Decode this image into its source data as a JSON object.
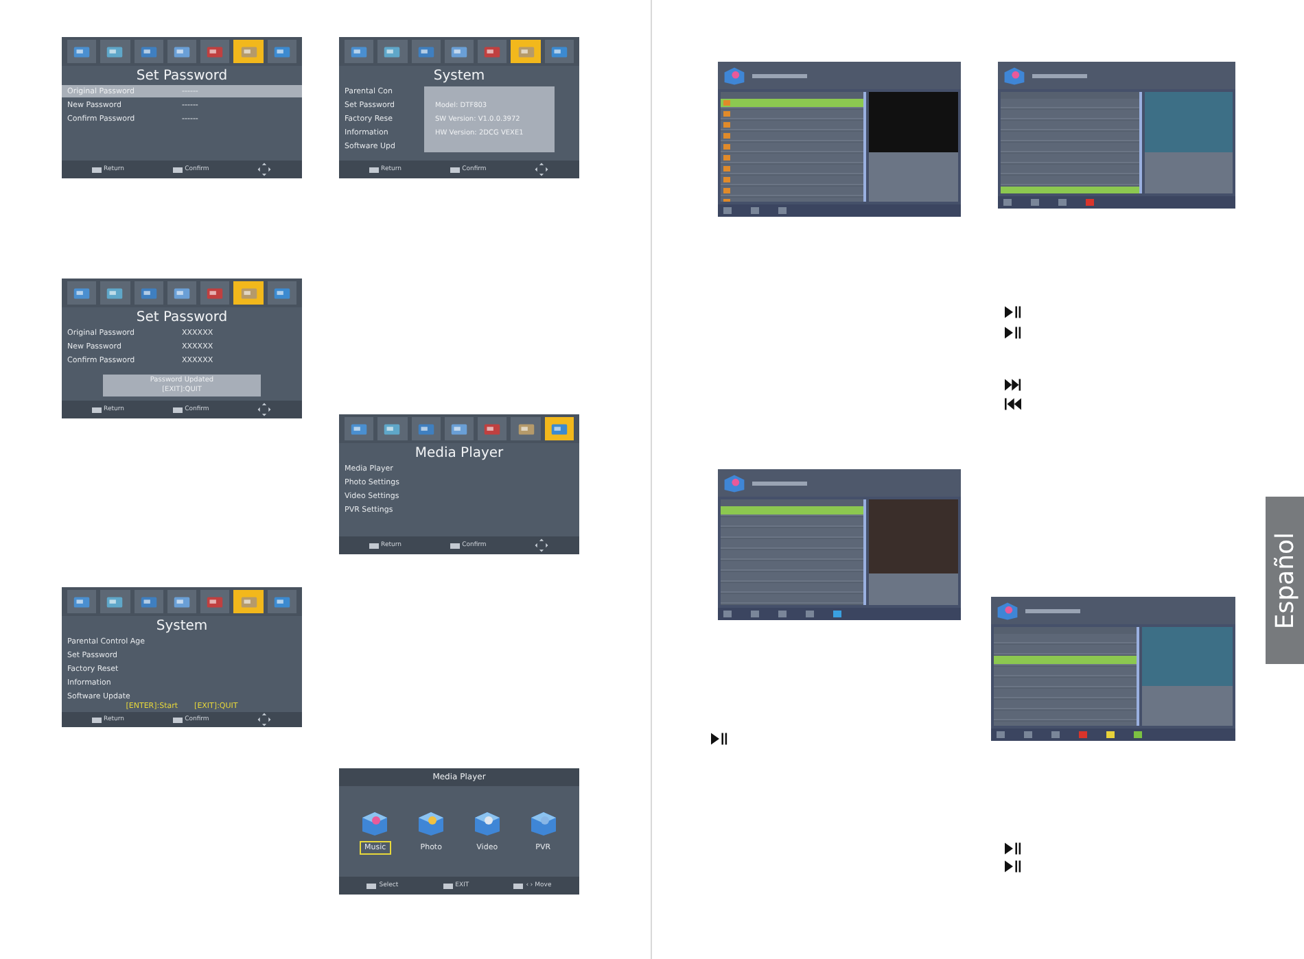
{
  "left_page": {
    "screens": [
      {
        "kind": "menu",
        "tabs": [
          {
            "selected": false
          },
          {
            "selected": false
          },
          {
            "selected": false
          },
          {
            "selected": false
          },
          {
            "selected": false
          },
          {
            "selected": true
          },
          {
            "selected": false
          }
        ],
        "title": "Set Password",
        "rows": [
          {
            "label": "Original Password",
            "value": "------",
            "selected": true
          },
          {
            "label": "New Password",
            "value": "------",
            "selected": false
          },
          {
            "label": "Confirm Password",
            "value": "------",
            "selected": false
          }
        ],
        "footer": [
          "Return",
          "Confirm"
        ]
      },
      {
        "kind": "menu",
        "tabs": [
          {
            "selected": false
          },
          {
            "selected": false
          },
          {
            "selected": false
          },
          {
            "selected": false
          },
          {
            "selected": false
          },
          {
            "selected": true
          },
          {
            "selected": false
          }
        ],
        "title": "System",
        "rows": [
          {
            "label": "Parental Con",
            "selected": false
          },
          {
            "label": "Set Password",
            "selected": false
          },
          {
            "label": "Factory Rese",
            "selected": false
          },
          {
            "label": "Information",
            "selected": false
          },
          {
            "label": "Software Upd",
            "selected": false
          }
        ],
        "popup": [
          "Model: DTF803",
          "SW Version: V1.0.0.3972",
          "HW Version: 2DCG VEXE1"
        ],
        "footer": [
          "Return",
          "Confirm"
        ]
      },
      {
        "kind": "menu",
        "tabs": [
          {
            "selected": false
          },
          {
            "selected": false
          },
          {
            "selected": false
          },
          {
            "selected": false
          },
          {
            "selected": false
          },
          {
            "selected": true
          },
          {
            "selected": false
          }
        ],
        "title": "Set Password",
        "rows": [
          {
            "label": "Original Password",
            "value": "XXXXXX",
            "selected": false
          },
          {
            "label": "New Password",
            "value": "XXXXXX",
            "selected": false
          },
          {
            "label": "Confirm Password",
            "value": "XXXXXX",
            "selected": false
          }
        ],
        "message": [
          "Password Updated",
          "[EXIT]:QUIT"
        ],
        "footer": [
          "Return",
          "Confirm"
        ]
      },
      {
        "kind": "menu",
        "tabs": [
          {
            "selected": false
          },
          {
            "selected": false
          },
          {
            "selected": false
          },
          {
            "selected": false
          },
          {
            "selected": false
          },
          {
            "selected": false
          },
          {
            "selected": true
          }
        ],
        "title": "Media Player",
        "rows": [
          {
            "label": "Media Player",
            "selected": false
          },
          {
            "label": "Photo Settings",
            "selected": false
          },
          {
            "label": "Video Settings",
            "selected": false
          },
          {
            "label": "PVR  Settings",
            "selected": false
          }
        ],
        "footer": [
          "Return",
          "Confirm"
        ]
      },
      {
        "kind": "menu",
        "tabs": [
          {
            "selected": false
          },
          {
            "selected": false
          },
          {
            "selected": false
          },
          {
            "selected": false
          },
          {
            "selected": false
          },
          {
            "selected": true
          },
          {
            "selected": false
          }
        ],
        "title": "System",
        "rows": [
          {
            "label": "Parental Control Age",
            "selected": false
          },
          {
            "label": "Set Password",
            "selected": false
          },
          {
            "label": "Factory Reset",
            "selected": false
          },
          {
            "label": "Information",
            "selected": false
          },
          {
            "label": "Software Update",
            "selected": false
          }
        ],
        "hints": [
          "[ENTER]:Start",
          "[EXIT]:QUIT"
        ],
        "footer": [
          "Return",
          "Confirm"
        ]
      },
      {
        "kind": "media",
        "title": "Media Player",
        "items": [
          {
            "label": "Music",
            "selected": true
          },
          {
            "label": "Photo",
            "selected": false
          },
          {
            "label": "Video",
            "selected": false
          },
          {
            "label": "PVR",
            "selected": false
          }
        ],
        "footer": [
          "Select",
          "EXIT",
          "‹ › Move"
        ]
      }
    ]
  },
  "right_page": {
    "browsers": [
      {
        "preview": {
          "kind": "black"
        },
        "rows": [
          {
            "kind": "folder",
            "selected": true
          },
          {
            "kind": "folder",
            "selected": false
          },
          {
            "kind": "folder",
            "selected": false
          },
          {
            "kind": "folder",
            "selected": false
          },
          {
            "kind": "folder",
            "selected": false
          },
          {
            "kind": "folder",
            "selected": false
          },
          {
            "kind": "folder",
            "selected": false
          },
          {
            "kind": "folder",
            "selected": false
          },
          {
            "kind": "folder",
            "selected": false
          },
          {
            "kind": "folder",
            "selected": false
          }
        ],
        "keys": [
          {
            "color": "#7a8699"
          },
          {
            "color": "#7a8699"
          },
          {
            "color": "#7a8699"
          }
        ]
      },
      {
        "preview": {
          "kind": "video"
        },
        "rows": [
          {
            "kind": "file",
            "selected": false
          },
          {
            "kind": "file",
            "selected": false
          },
          {
            "kind": "file",
            "selected": false
          },
          {
            "kind": "file",
            "selected": false
          },
          {
            "kind": "file",
            "selected": false
          },
          {
            "kind": "file",
            "selected": false
          },
          {
            "kind": "file",
            "selected": false
          },
          {
            "kind": "file",
            "selected": false
          },
          {
            "kind": "file",
            "selected": true
          }
        ],
        "keys": [
          {
            "color": "#7a8699"
          },
          {
            "color": "#7a8699"
          },
          {
            "color": "#7a8699"
          },
          {
            "color": "#d9342b"
          }
        ]
      },
      {
        "preview": {
          "kind": "photo"
        },
        "rows": [
          {
            "kind": "file",
            "selected": true
          },
          {
            "kind": "file",
            "selected": false
          },
          {
            "kind": "file",
            "selected": false
          },
          {
            "kind": "file",
            "selected": false
          },
          {
            "kind": "file",
            "selected": false
          },
          {
            "kind": "file",
            "selected": false
          },
          {
            "kind": "file",
            "selected": false
          },
          {
            "kind": "file",
            "selected": false
          },
          {
            "kind": "file",
            "selected": false
          }
        ],
        "keys": [
          {
            "color": "#7a8699"
          },
          {
            "color": "#7a8699"
          },
          {
            "color": "#7a8699"
          },
          {
            "color": "#7a8699"
          },
          {
            "color": "#3aa0e0"
          }
        ]
      },
      {
        "preview": {
          "kind": "video"
        },
        "rows": [
          {
            "kind": "file",
            "selected": false
          },
          {
            "kind": "file",
            "selected": false
          },
          {
            "kind": "file",
            "selected": true
          },
          {
            "kind": "file",
            "selected": false
          },
          {
            "kind": "file",
            "selected": false
          },
          {
            "kind": "file",
            "selected": false
          },
          {
            "kind": "file",
            "selected": false
          },
          {
            "kind": "file",
            "selected": false
          },
          {
            "kind": "file",
            "selected": false
          }
        ],
        "keys": [
          {
            "color": "#7a8699"
          },
          {
            "color": "#7a8699"
          },
          {
            "color": "#7a8699"
          },
          {
            "color": "#d9342b"
          },
          {
            "color": "#e8d23a"
          },
          {
            "color": "#7cc242"
          }
        ]
      }
    ],
    "symbols": [
      {
        "kind": "play_pause"
      },
      {
        "kind": "play_pause"
      },
      {
        "kind": "next"
      },
      {
        "kind": "previous"
      },
      {
        "kind": "play_pause"
      },
      {
        "kind": "play_pause"
      },
      {
        "kind": "play_pause"
      }
    ],
    "language_tab": "Español"
  }
}
